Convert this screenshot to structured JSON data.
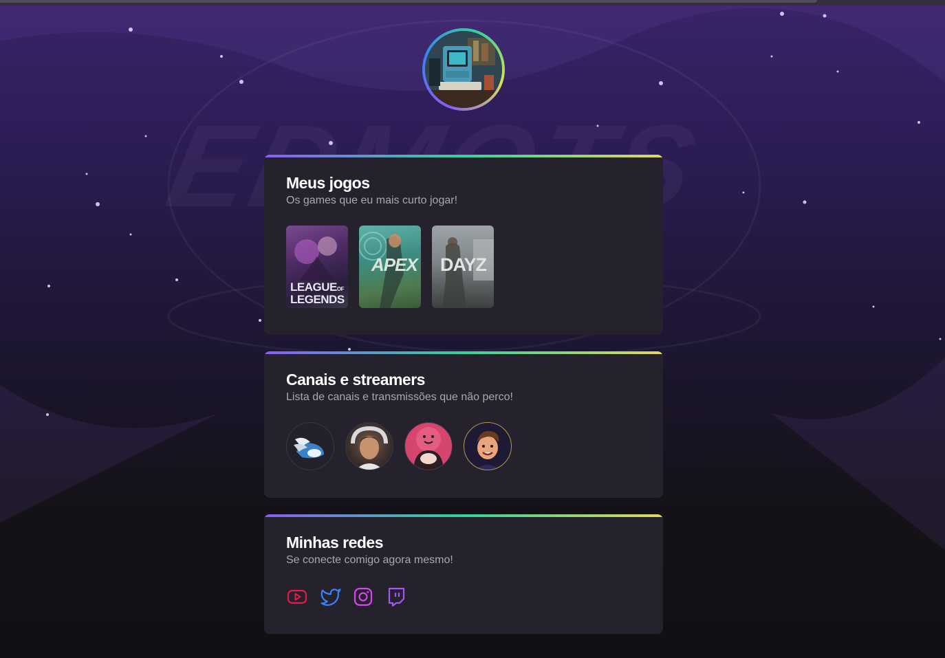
{
  "profile": {
    "avatar_alt": "retro-computer-avatar"
  },
  "games_section": {
    "title": "Meus jogos",
    "subtitle": "Os games que eu mais curto jogar!",
    "games": [
      {
        "name": "League of Legends",
        "logo_line1": "LEAGUE",
        "logo_of": "OF",
        "logo_line2": "LEGENDS"
      },
      {
        "name": "Apex Legends",
        "logo": "APEX"
      },
      {
        "name": "DayZ",
        "logo": "DAYZ"
      }
    ]
  },
  "streamers_section": {
    "title": "Canais e streamers",
    "subtitle": "Lista de canais e transmissões que não perco!",
    "streamers": [
      {
        "id": "streamer-1"
      },
      {
        "id": "streamer-2"
      },
      {
        "id": "streamer-3"
      },
      {
        "id": "streamer-4"
      }
    ]
  },
  "social_section": {
    "title": "Minhas redes",
    "subtitle": "Se conecte comigo agora mesmo!",
    "links": [
      {
        "icon": "youtube-icon",
        "color": "#e11d48"
      },
      {
        "icon": "twitter-icon",
        "color": "#3b82f6"
      },
      {
        "icon": "instagram-icon",
        "color": "#d946ef"
      },
      {
        "icon": "twitch-icon",
        "color": "#a855f7"
      }
    ]
  }
}
